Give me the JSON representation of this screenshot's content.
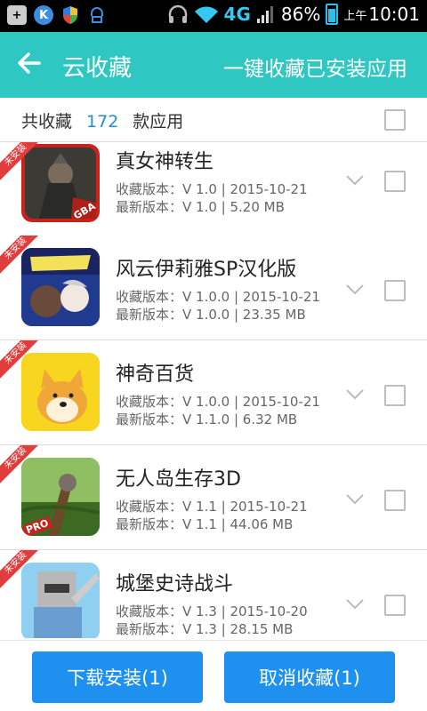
{
  "status_bar": {
    "network": "4G",
    "battery": "86%",
    "ampm": "上午",
    "time": "10:01",
    "colors": {
      "accent": "#34c8f2"
    }
  },
  "header": {
    "title": "云收藏",
    "action": "一键收藏已安装应用",
    "back_icon": "arrow-left-icon",
    "color": "#2fc7c1"
  },
  "summary": {
    "prefix": "共收藏",
    "count": "172",
    "suffix": "款应用"
  },
  "apps": [
    {
      "badge": "未安装",
      "name": "真女神转生",
      "fav_version": "收藏版本：V 1.0 | 2015-10-21",
      "latest_version": "最新版本：V 1.0 | 5.20 MB",
      "icon_style": "dark-warrior",
      "icon_label": "GBA"
    },
    {
      "badge": "未安装",
      "name": "风云伊莉雅SP汉化版",
      "fav_version": "收藏版本：V 1.0.0 | 2015-10-21",
      "latest_version": "最新版本：V 1.0.0 | 23.35 MB",
      "icon_style": "anime-poster",
      "icon_label": ""
    },
    {
      "badge": "未安装",
      "name": "神奇百货",
      "fav_version": "收藏版本：V 1.0.0 | 2015-10-21",
      "latest_version": "最新版本：V 1.1.0 | 6.32 MB",
      "icon_style": "doge",
      "icon_label": ""
    },
    {
      "badge": "未安装",
      "name": "无人岛生存3D",
      "fav_version": "收藏版本：V 1.1 | 2015-10-21",
      "latest_version": "最新版本：V 1.1 | 44.06 MB",
      "icon_style": "island",
      "icon_label": "PRO"
    },
    {
      "badge": "未安装",
      "name": "城堡史诗战斗",
      "fav_version": "收藏版本：V 1.3 | 2015-10-20",
      "latest_version": "最新版本：V 1.3 | 28.15 MB",
      "icon_style": "blocky-knight",
      "icon_label": ""
    }
  ],
  "footer": {
    "install_label": "下载安装(1)",
    "cancel_label": "取消收藏(1)",
    "button_color": "#1e90f0"
  }
}
